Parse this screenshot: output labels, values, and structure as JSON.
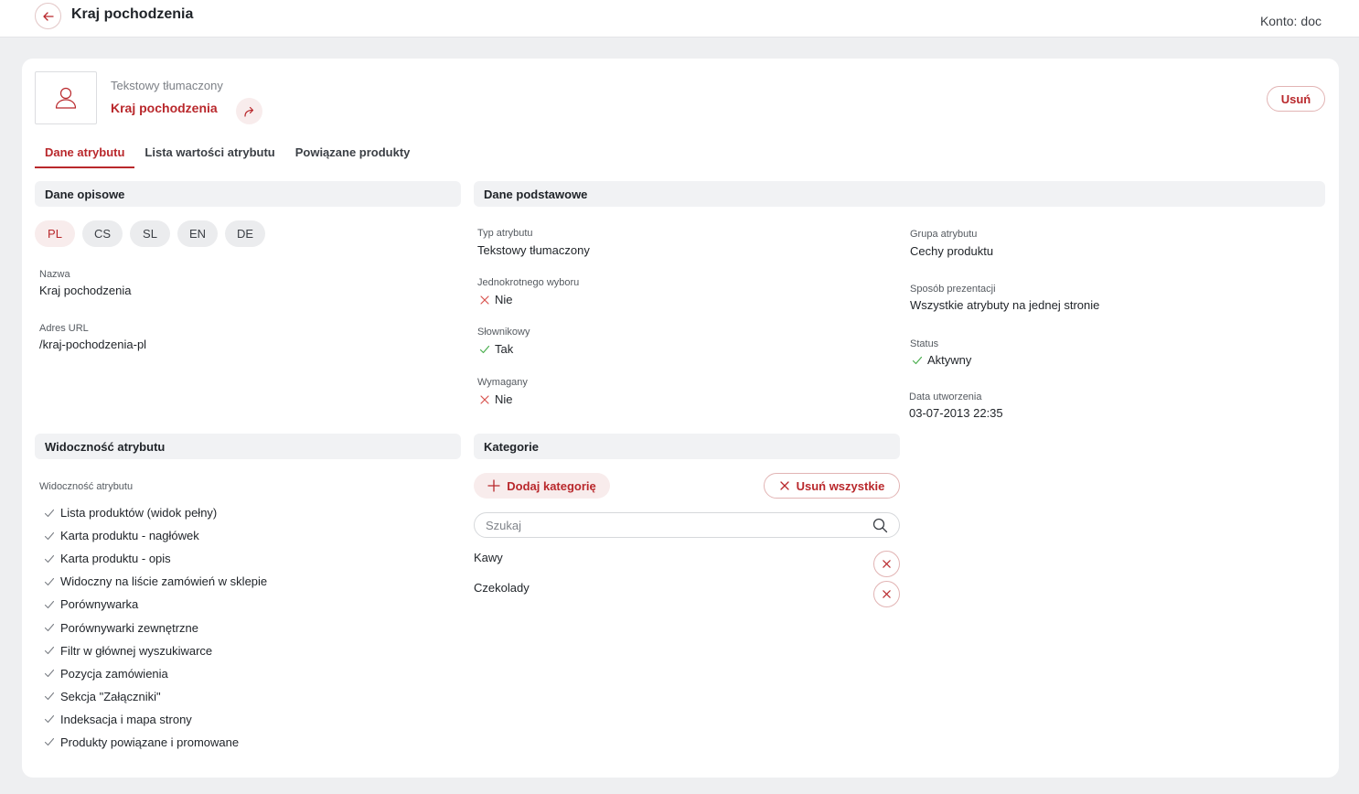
{
  "header": {
    "title": "Kraj pochodzenia",
    "account_label": "Konto:",
    "account_value": "doc"
  },
  "attribute": {
    "type_label": "Tekstowy tłumaczony",
    "name": "Kraj pochodzenia",
    "delete_label": "Usuń"
  },
  "tabs": [
    {
      "label": "Dane atrybutu",
      "active": true
    },
    {
      "label": "Lista wartości atrybutu",
      "active": false
    },
    {
      "label": "Powiązane produkty",
      "active": false
    }
  ],
  "descriptive": {
    "title": "Dane opisowe",
    "languages": [
      "PL",
      "CS",
      "SL",
      "EN",
      "DE"
    ],
    "active_language": "PL",
    "name_label": "Nazwa",
    "name_value": "Kraj pochodzenia",
    "url_label": "Adres URL",
    "url_value": "/kraj-pochodzenia-pl"
  },
  "basic": {
    "title": "Dane podstawowe",
    "type_label": "Typ atrybutu",
    "type_value": "Tekstowy tłumaczony",
    "single_label": "Jednokrotnego wyboru",
    "single_value": "Nie",
    "dictionary_label": "Słownikowy",
    "dictionary_value": "Tak",
    "required_label": "Wymagany",
    "required_value": "Nie",
    "group_label": "Grupa atrybutu",
    "group_value": "Cechy produktu",
    "presentation_label": "Sposób prezentacji",
    "presentation_value": "Wszystkie atrybuty na jednej stronie",
    "status_label": "Status",
    "status_value": "Aktywny",
    "created_label": "Data utworzenia",
    "created_value": "03-07-2013 22:35"
  },
  "visibility": {
    "title": "Widoczność atrybutu",
    "subtitle": "Widoczność atrybutu",
    "items": [
      "Lista produktów (widok pełny)",
      "Karta produktu - nagłówek",
      "Karta produktu - opis",
      "Widoczny na liście zamówień w sklepie",
      "Porównywarka",
      "Porównywarki zewnętrzne",
      "Filtr w głównej wyszukiwarce",
      "Pozycja zamówienia",
      "Sekcja \"Załączniki\"",
      "Indeksacja i mapa strony",
      "Produkty powiązane i promowane"
    ]
  },
  "categories": {
    "title": "Kategorie",
    "add_label": "Dodaj kategorię",
    "remove_all_label": "Usuń wszystkie",
    "search_placeholder": "Szukaj",
    "items": [
      "Kawy",
      "Czekolady"
    ]
  },
  "colors": {
    "accent": "#b9282c",
    "accent_soft": "#f8ecec",
    "success": "#4caf50",
    "section_bg": "#f1f2f4"
  }
}
